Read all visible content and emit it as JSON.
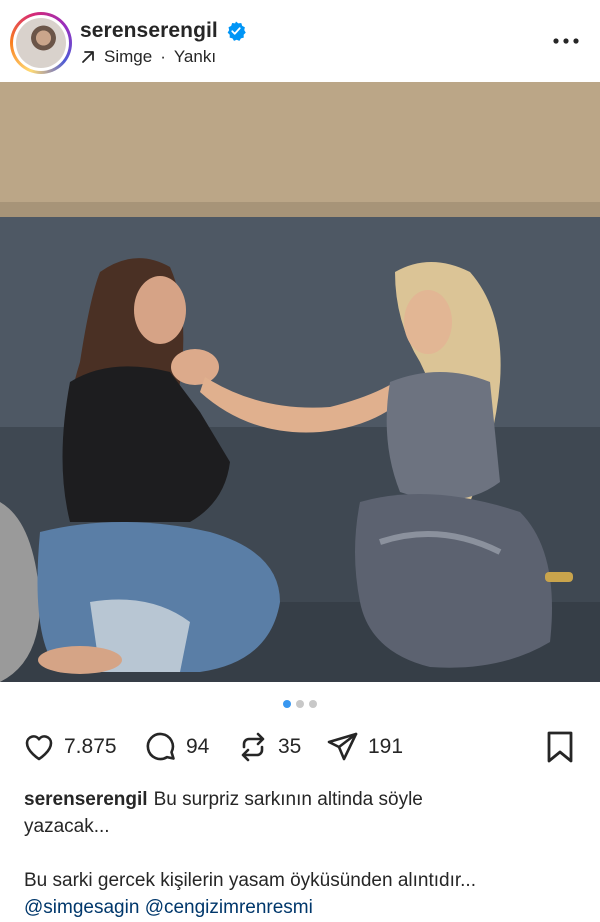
{
  "post": {
    "username": "serenserengil",
    "music": {
      "artist": "Simge",
      "separator": "·",
      "title": "Yankı"
    },
    "media": {
      "slide_count": 3,
      "active_slide": 1
    },
    "stats": {
      "likes": "7.875",
      "comments": "94",
      "reposts": "35",
      "shares": "191"
    },
    "caption": {
      "author": "serenserengil",
      "line1_rest": "Bu surpriz sarkının altinda söyle",
      "line2": "yazacak...",
      "line3": "Bu sarki gercek kişilerin yasam öyküsünden alıntıdır...",
      "mentions": [
        "@simgesagin",
        "@cengizimrenresmi"
      ]
    }
  },
  "colors": {
    "link": "#00376b",
    "dot_active": "#3897f0",
    "verified": "#0095f6"
  },
  "icons": {
    "verified": "verified-badge-icon",
    "music_arrow": "arrow-up-right-icon",
    "more": "more-horizontal-icon",
    "mute": "speaker-muted-icon",
    "like": "heart-icon",
    "comment": "comment-bubble-icon",
    "repost": "repost-icon",
    "share": "paper-plane-icon",
    "save": "bookmark-icon"
  }
}
